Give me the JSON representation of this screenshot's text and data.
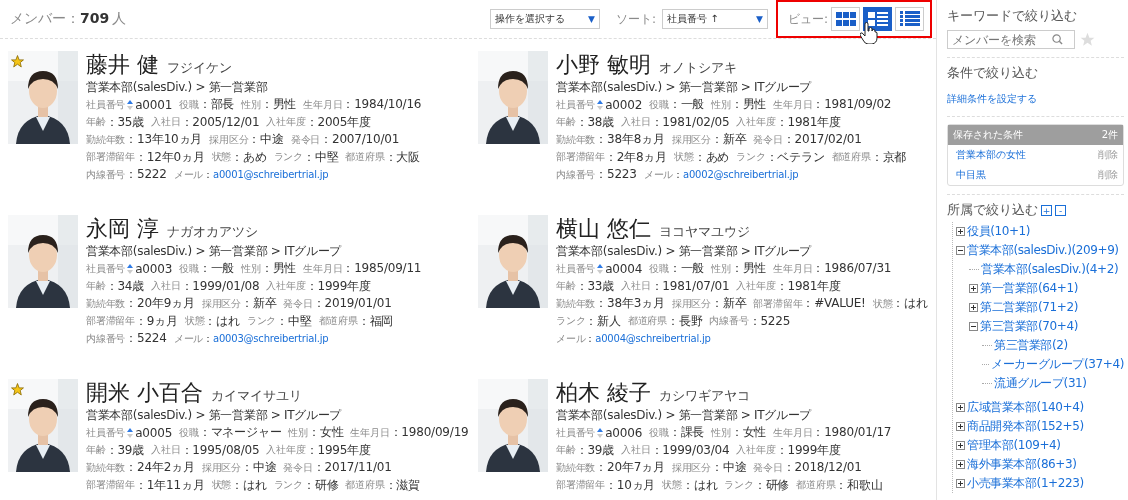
{
  "header": {
    "count_label": "メンバー：",
    "count": "709",
    "count_unit": "人",
    "action_select": {
      "value": "操作を選択する",
      "caret": "▼"
    },
    "sort_label": "ソート:",
    "sort_select": {
      "value": "社員番号 ↑",
      "caret": "▼"
    },
    "view_label": "ビュー:",
    "views": [
      {
        "kind": "grid",
        "selected": false
      },
      {
        "kind": "cards",
        "selected": true
      },
      {
        "kind": "list",
        "selected": false
      }
    ]
  },
  "members": [
    {
      "name": "藤井 健",
      "kana": "フジイケン",
      "path": "営業本部(salesDiv.) > 第一営業部",
      "starred": true,
      "lines": [
        [
          {
            "kind": "id",
            "label": "社員番号",
            "value": "a0001"
          },
          {
            "kind": "text",
            "label": "役職",
            "value": "：部長"
          },
          {
            "kind": "text",
            "label": "性別",
            "value": "：男性"
          },
          {
            "kind": "text",
            "label": "生年月日",
            "value": "：1984/10/16"
          }
        ],
        [
          {
            "kind": "text",
            "label": "年齢",
            "value": "：35歳"
          },
          {
            "kind": "text",
            "label": "入社日",
            "value": "：2005/12/01"
          },
          {
            "kind": "text",
            "label": "入社年度",
            "value": "：2005年度"
          }
        ],
        [
          {
            "kind": "text",
            "label": "勤続年数",
            "value": "：13年10ヵ月"
          },
          {
            "kind": "text",
            "label": "採用区分",
            "value": "：中途"
          },
          {
            "kind": "text",
            "label": "発令日",
            "value": "：2007/10/01"
          }
        ],
        [
          {
            "kind": "text",
            "label": "部署滞留年",
            "value": "：12年0ヵ月"
          },
          {
            "kind": "text",
            "label": "状態",
            "value": "：あめ"
          },
          {
            "kind": "text",
            "label": "ランク",
            "value": "：中堅"
          },
          {
            "kind": "text",
            "label": "都道府県",
            "value": "：大阪"
          }
        ],
        [
          {
            "kind": "text",
            "label": "内線番号",
            "value": "：5222"
          },
          {
            "kind": "link",
            "label": "メール",
            "sep": "：",
            "value": "a0001@schreibertrial.jp"
          }
        ]
      ]
    },
    {
      "name": "小野 敏明",
      "kana": "オノトシアキ",
      "path": "営業本部(salesDiv.) > 第一営業部 > ITグループ",
      "starred": false,
      "lines": [
        [
          {
            "kind": "id",
            "label": "社員番号",
            "value": "a0002"
          },
          {
            "kind": "text",
            "label": "役職",
            "value": "：一般"
          },
          {
            "kind": "text",
            "label": "性別",
            "value": "：男性"
          },
          {
            "kind": "text",
            "label": "生年月日",
            "value": "：1981/09/02"
          }
        ],
        [
          {
            "kind": "text",
            "label": "年齢",
            "value": "：38歳"
          },
          {
            "kind": "text",
            "label": "入社日",
            "value": "：1981/02/05"
          },
          {
            "kind": "text",
            "label": "入社年度",
            "value": "：1981年度"
          }
        ],
        [
          {
            "kind": "text",
            "label": "勤続年数",
            "value": "：38年8ヵ月"
          },
          {
            "kind": "text",
            "label": "採用区分",
            "value": "：新卒"
          },
          {
            "kind": "text",
            "label": "発令日",
            "value": "：2017/02/01"
          }
        ],
        [
          {
            "kind": "text",
            "label": "部署滞留年",
            "value": "：2年8ヵ月"
          },
          {
            "kind": "text",
            "label": "状態",
            "value": "：あめ"
          },
          {
            "kind": "text",
            "label": "ランク",
            "value": "：ベテラン"
          },
          {
            "kind": "text",
            "label": "都道府県",
            "value": "：京都"
          }
        ],
        [
          {
            "kind": "text",
            "label": "内線番号",
            "value": "：5223"
          },
          {
            "kind": "link",
            "label": "メール",
            "sep": "：",
            "value": "a0002@schreibertrial.jp"
          }
        ]
      ]
    },
    {
      "name": "永岡 淳",
      "kana": "ナガオカアツシ",
      "path": "営業本部(salesDiv.) > 第一営業部 > ITグループ",
      "starred": false,
      "lines": [
        [
          {
            "kind": "id",
            "label": "社員番号",
            "value": "a0003"
          },
          {
            "kind": "text",
            "label": "役職",
            "value": "：一般"
          },
          {
            "kind": "text",
            "label": "性別",
            "value": "：男性"
          },
          {
            "kind": "text",
            "label": "生年月日",
            "value": "：1985/09/11"
          }
        ],
        [
          {
            "kind": "text",
            "label": "年齢",
            "value": "：34歳"
          },
          {
            "kind": "text",
            "label": "入社日",
            "value": "：1999/01/08"
          },
          {
            "kind": "text",
            "label": "入社年度",
            "value": "：1999年度"
          }
        ],
        [
          {
            "kind": "text",
            "label": "勤続年数",
            "value": "：20年9ヵ月"
          },
          {
            "kind": "text",
            "label": "採用区分",
            "value": "：新卒"
          },
          {
            "kind": "text",
            "label": "発令日",
            "value": "：2019/01/01"
          }
        ],
        [
          {
            "kind": "text",
            "label": "部署滞留年",
            "value": "：9ヵ月"
          },
          {
            "kind": "text",
            "label": "状態",
            "value": "：はれ"
          },
          {
            "kind": "text",
            "label": "ランク",
            "value": "：中堅"
          },
          {
            "kind": "text",
            "label": "都道府県",
            "value": "：福岡"
          }
        ],
        [
          {
            "kind": "text",
            "label": "内線番号",
            "value": "：5224"
          },
          {
            "kind": "link",
            "label": "メール",
            "sep": "：",
            "value": "a0003@schreibertrial.jp"
          }
        ]
      ]
    },
    {
      "name": "横山 悠仁",
      "kana": "ヨコヤマユウジ",
      "path": "営業本部(salesDiv.) > 第一営業部 > ITグループ",
      "starred": false,
      "lines": [
        [
          {
            "kind": "id",
            "label": "社員番号",
            "value": "a0004"
          },
          {
            "kind": "text",
            "label": "役職",
            "value": "：一般"
          },
          {
            "kind": "text",
            "label": "性別",
            "value": "：男性"
          },
          {
            "kind": "text",
            "label": "生年月日",
            "value": "：1986/07/31"
          }
        ],
        [
          {
            "kind": "text",
            "label": "年齢",
            "value": "：33歳"
          },
          {
            "kind": "text",
            "label": "入社日",
            "value": "：1981/07/01"
          },
          {
            "kind": "text",
            "label": "入社年度",
            "value": "：1981年度"
          }
        ],
        [
          {
            "kind": "text",
            "label": "勤続年数",
            "value": "：38年3ヵ月"
          },
          {
            "kind": "text",
            "label": "採用区分",
            "value": "：新卒"
          },
          {
            "kind": "text",
            "label": "部署滞留年",
            "value": "：#VALUE!"
          },
          {
            "kind": "text",
            "label": "状態",
            "value": "：はれ"
          }
        ],
        [
          {
            "kind": "text",
            "label": "ランク",
            "value": "：新人"
          },
          {
            "kind": "text",
            "label": "都道府県",
            "value": "：長野"
          },
          {
            "kind": "text",
            "label": "内線番号",
            "value": "：5225"
          }
        ],
        [
          {
            "kind": "link",
            "label": "メール",
            "sep": "：",
            "value": "a0004@schreibertrial.jp"
          }
        ]
      ]
    },
    {
      "name": "開米 小百合",
      "kana": "カイマイサユリ",
      "path": "営業本部(salesDiv.) > 第一営業部 > ITグループ",
      "starred": true,
      "lines": [
        [
          {
            "kind": "id",
            "label": "社員番号",
            "value": "a0005"
          },
          {
            "kind": "text",
            "label": "役職",
            "value": "：マネージャー"
          },
          {
            "kind": "text",
            "label": "性別",
            "value": "：女性"
          },
          {
            "kind": "text",
            "label": "生年月日",
            "value": "：1980/09/19"
          }
        ],
        [
          {
            "kind": "text",
            "label": "年齢",
            "value": "：39歳"
          },
          {
            "kind": "text",
            "label": "入社日",
            "value": "：1995/08/05"
          },
          {
            "kind": "text",
            "label": "入社年度",
            "value": "：1995年度"
          }
        ],
        [
          {
            "kind": "text",
            "label": "勤続年数",
            "value": "：24年2ヵ月"
          },
          {
            "kind": "text",
            "label": "採用区分",
            "value": "：中途"
          },
          {
            "kind": "text",
            "label": "発令日",
            "value": "：2017/11/01"
          }
        ],
        [
          {
            "kind": "text",
            "label": "部署滞留年",
            "value": "：1年11ヵ月"
          },
          {
            "kind": "text",
            "label": "状態",
            "value": "：はれ"
          },
          {
            "kind": "text",
            "label": "ランク",
            "value": "：研修"
          },
          {
            "kind": "text",
            "label": "都道府県",
            "value": "：滋賀"
          }
        ]
      ]
    },
    {
      "name": "柏木 綾子",
      "kana": "カシワギアヤコ",
      "path": "営業本部(salesDiv.) > 第一営業部 > ITグループ",
      "starred": false,
      "lines": [
        [
          {
            "kind": "id",
            "label": "社員番号",
            "value": "a0006"
          },
          {
            "kind": "text",
            "label": "役職",
            "value": "：課長"
          },
          {
            "kind": "text",
            "label": "性別",
            "value": "：女性"
          },
          {
            "kind": "text",
            "label": "生年月日",
            "value": "：1980/01/17"
          }
        ],
        [
          {
            "kind": "text",
            "label": "年齢",
            "value": "：39歳"
          },
          {
            "kind": "text",
            "label": "入社日",
            "value": "：1999/03/04"
          },
          {
            "kind": "text",
            "label": "入社年度",
            "value": "：1999年度"
          }
        ],
        [
          {
            "kind": "text",
            "label": "勤続年数",
            "value": "：20年7ヵ月"
          },
          {
            "kind": "text",
            "label": "採用区分",
            "value": "：中途"
          },
          {
            "kind": "text",
            "label": "発令日",
            "value": "：2018/12/01"
          }
        ],
        [
          {
            "kind": "text",
            "label": "部署滞留年",
            "value": "：10ヵ月"
          },
          {
            "kind": "text",
            "label": "状態",
            "value": "：はれ"
          },
          {
            "kind": "text",
            "label": "ランク",
            "value": "：研修"
          },
          {
            "kind": "text",
            "label": "都道府県",
            "value": "：和歌山"
          }
        ]
      ]
    }
  ],
  "sidebar": {
    "keyword_title": "キーワードで絞り込む",
    "search": {
      "placeholder": "メンバーを検索"
    },
    "condition_title": "条件で絞り込む",
    "condition_link": "詳細条件を設定する",
    "saved": {
      "title": "保存された条件",
      "count": "2件",
      "items": [
        {
          "name": "営業本部の女性",
          "action": "削除"
        },
        {
          "name": "中目黒",
          "action": "削除"
        }
      ]
    },
    "tree_title": "所属で絞り込む",
    "expand_all": "+",
    "collapse_all": "-",
    "tree": [
      {
        "label": "役員(10+1)",
        "expanded": false
      },
      {
        "label": "営業本部(salesDiv.)(209+9)",
        "expanded": true,
        "children": [
          {
            "label": "営業本部(salesDiv.)(4+2)"
          },
          {
            "label": "第一営業部(64+1)",
            "expanded": false
          },
          {
            "label": "第二営業部(71+2)",
            "expanded": false
          },
          {
            "label": "第三営業部(70+4)",
            "expanded": true,
            "children": [
              {
                "label": "第三営業部(2)"
              },
              {
                "label": "メーカーグループ(37+4)"
              },
              {
                "label": "流通グループ(31)"
              }
            ]
          }
        ]
      },
      {
        "label": "広域営業本部(140+4)",
        "expanded": false
      },
      {
        "label": "商品開発本部(152+5)",
        "expanded": false
      },
      {
        "label": "管理本部(109+4)",
        "expanded": false
      },
      {
        "label": "海外事業本部(86+3)",
        "expanded": false
      },
      {
        "label": "小売事業本部(1+223)",
        "expanded": false
      }
    ]
  }
}
